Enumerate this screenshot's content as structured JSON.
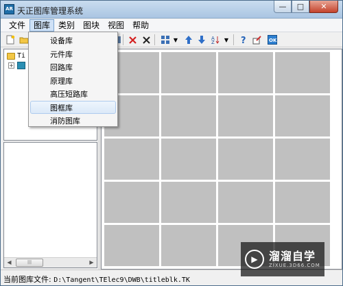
{
  "window": {
    "title": "天正图库管理系统",
    "app_icon_text": "AR"
  },
  "titlebar_buttons": {
    "minimize": "—",
    "maximize": "□",
    "close": "✕"
  },
  "menubar": {
    "items": [
      {
        "label": "文件"
      },
      {
        "label": "图库"
      },
      {
        "label": "类别"
      },
      {
        "label": "图块"
      },
      {
        "label": "视图"
      },
      {
        "label": "帮助"
      }
    ],
    "active_index": 1
  },
  "dropdown": {
    "items": [
      {
        "label": "设备库"
      },
      {
        "label": "元件库"
      },
      {
        "label": "回路库"
      },
      {
        "label": "原理库"
      },
      {
        "label": "高压短路库"
      },
      {
        "label": "图框库"
      },
      {
        "label": "消防图库"
      }
    ],
    "highlighted_index": 5
  },
  "toolbar": {
    "icons": [
      "new-icon",
      "open-folder-icon",
      "save-icon",
      "delete-red-icon",
      "delete-icon",
      "view-mode-icon",
      "dropdown-arrow-icon",
      "move-up-icon",
      "move-down-icon",
      "sort-icon",
      "dropdown-arrow-icon",
      "help-icon",
      "edit-icon",
      "ok-icon"
    ]
  },
  "tree": {
    "root_label": "Ti",
    "child_label": ""
  },
  "scrollbar": {
    "left_arrow": "◀",
    "right_arrow": "▶",
    "thumb_grip": "|||"
  },
  "preview": {
    "rows": 5,
    "columns": 4,
    "cell_color": "#c0c0c0"
  },
  "statusbar": {
    "label": "当前图库文件:",
    "path": "D:\\Tangent\\TElec9\\DWB\\titleblk.TK"
  },
  "watermark": {
    "title": "溜溜自学",
    "url": "ZIXUE.3D66.COM"
  },
  "colors": {
    "menu_highlight": "#cfe1f6",
    "delete_red": "#d42020",
    "accent_blue": "#1f6ea8"
  }
}
